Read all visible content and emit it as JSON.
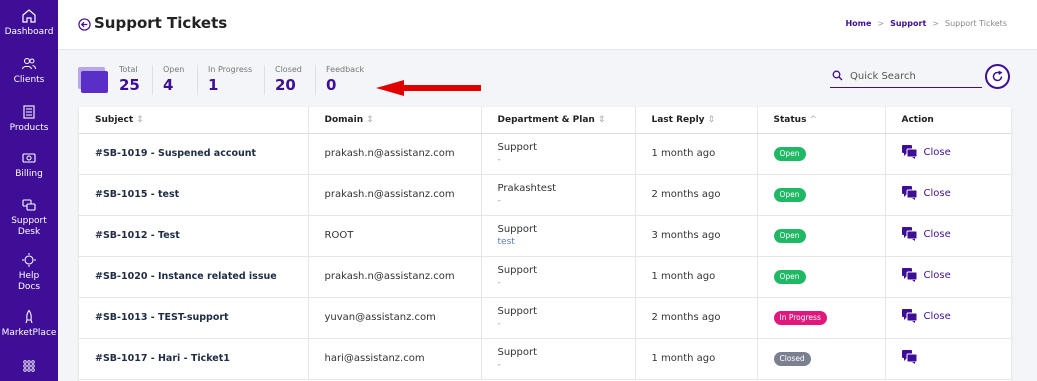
{
  "sidebar": {
    "items": [
      {
        "label": "Dashboard",
        "icon": "home-icon"
      },
      {
        "label": "Clients",
        "icon": "users-icon"
      },
      {
        "label": "Products",
        "icon": "products-icon"
      },
      {
        "label": "Billing",
        "icon": "billing-icon"
      },
      {
        "label": "Support",
        "label2": "Desk",
        "icon": "support-desk-icon"
      },
      {
        "label": "Help",
        "label2": "Docs",
        "icon": "help-docs-icon"
      },
      {
        "label": "MarketPlace",
        "icon": "marketplace-icon"
      },
      {
        "label": "",
        "icon": "more-apps-icon"
      }
    ]
  },
  "header": {
    "title": "Support Tickets",
    "breadcrumb": [
      "Home",
      "Support",
      "Support Tickets"
    ]
  },
  "stats": [
    {
      "label": "Total",
      "value": "25"
    },
    {
      "label": "Open",
      "value": "4"
    },
    {
      "label": "In Progress",
      "value": "1"
    },
    {
      "label": "Closed",
      "value": "20"
    },
    {
      "label": "Feedback",
      "value": "0"
    }
  ],
  "search": {
    "placeholder": "Quick Search"
  },
  "table": {
    "columns": [
      {
        "label": "Subject",
        "sort": "⇕"
      },
      {
        "label": "Domain",
        "sort": "⇕"
      },
      {
        "label": "Department & Plan",
        "sort": "⇕"
      },
      {
        "label": "Last Reply",
        "sort": "⇕"
      },
      {
        "label": "Status",
        "sort": "^"
      },
      {
        "label": "Action",
        "sort": ""
      }
    ],
    "rows": [
      {
        "subject": "#SB-1019 - Suspened account",
        "domain": "prakash.n@assistanz.com",
        "department": "Support",
        "plan": "-",
        "last_reply": "1 month ago",
        "status": "Open",
        "action": "Close"
      },
      {
        "subject": "#SB-1015 - test",
        "domain": "prakash.n@assistanz.com",
        "department": "Prakashtest",
        "plan": "-",
        "last_reply": "2 months ago",
        "status": "Open",
        "action": "Close"
      },
      {
        "subject": "#SB-1012 - Test",
        "domain": "ROOT",
        "department": "Support",
        "plan": "test",
        "last_reply": "3 months ago",
        "status": "Open",
        "action": "Close"
      },
      {
        "subject": "#SB-1020 - Instance related issue",
        "domain": "prakash.n@assistanz.com",
        "department": "Support",
        "plan": "-",
        "last_reply": "1 month ago",
        "status": "Open",
        "action": "Close"
      },
      {
        "subject": "#SB-1013 - TEST-support",
        "domain": "yuvan@assistanz.com",
        "department": "Support",
        "plan": "-",
        "last_reply": "2 months ago",
        "status": "In Progress",
        "action": "Close"
      },
      {
        "subject": "#SB-1017 - Hari - Ticket1",
        "domain": "hari@assistanz.com",
        "department": "Support",
        "plan": "-",
        "last_reply": "1 month ago",
        "status": "Closed",
        "action": ""
      }
    ]
  },
  "colors": {
    "brand": "#3e0f96",
    "status_open": "#1fb864",
    "status_in_progress": "#e0177d",
    "status_closed": "#7b8091",
    "annotation_arrow": "#e00000"
  }
}
